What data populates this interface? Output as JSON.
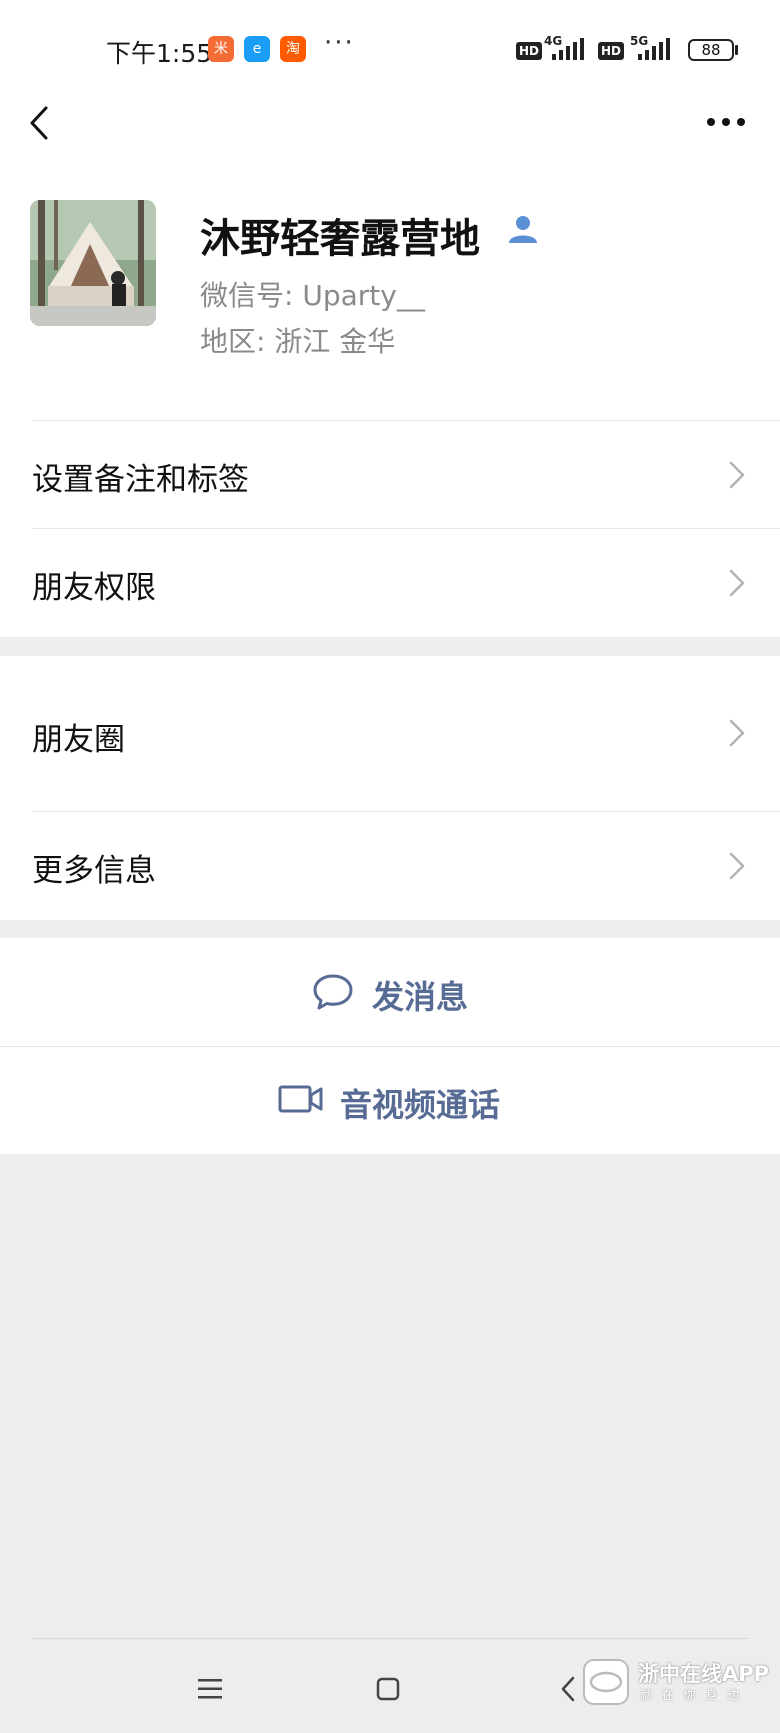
{
  "status_bar": {
    "time": "下午1:55",
    "app_badges": [
      {
        "name": "xiaomi-app-icon",
        "color": "#f46b36",
        "glyph": "米"
      },
      {
        "name": "eleme-app-icon",
        "color": "#1a9ef5",
        "glyph": "e"
      },
      {
        "name": "taobao-app-icon",
        "color": "#ff5b00",
        "glyph": "淘"
      }
    ],
    "more": "···",
    "hd1": "HD",
    "net1": "4G",
    "hd2": "HD",
    "net2": "5G",
    "battery": "88"
  },
  "profile": {
    "name": "沐野轻奢露营地",
    "wechat_id": "微信号:  Uparty__",
    "region": "地区:  浙江  金华"
  },
  "menu_group1": [
    {
      "label": "设置备注和标签"
    },
    {
      "label": "朋友权限"
    }
  ],
  "menu_group2": [
    {
      "label": "朋友圈"
    },
    {
      "label": "更多信息"
    }
  ],
  "actions": {
    "message": "发消息",
    "call": "音视频通话"
  },
  "watermark": {
    "title": "浙中在线APP",
    "subtitle": "就 在 你 身 边"
  },
  "colors": {
    "link": "#576b95",
    "background": "#ededed"
  }
}
